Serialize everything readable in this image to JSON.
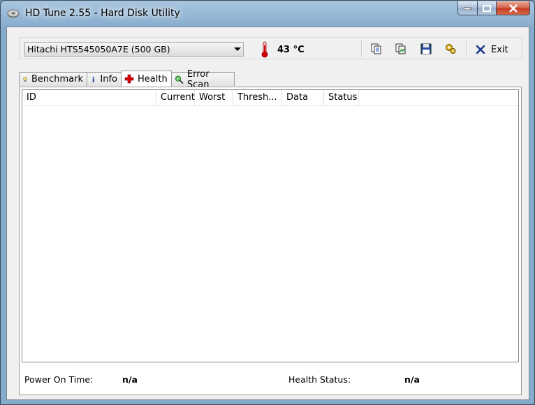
{
  "window": {
    "title": "HD Tune 2.55 - Hard Disk Utility",
    "controls": [
      "minimize",
      "maximize",
      "close"
    ]
  },
  "toolbar": {
    "drive_select_value": "Hitachi HTS545050A7E (500 GB)",
    "temperature": "43 °C",
    "icons": [
      "copy-info-icon",
      "copy-screenshot-icon",
      "save-icon",
      "options-icon",
      "exit-icon"
    ],
    "exit_label": "Exit"
  },
  "tabs": [
    {
      "label": "Benchmark",
      "icon": "benchmark-icon"
    },
    {
      "label": "Info",
      "icon": "info-icon"
    },
    {
      "label": "Health",
      "icon": "health-cross-icon",
      "active": true
    },
    {
      "label": "Error Scan",
      "icon": "magnifier-icon"
    }
  ],
  "health": {
    "columns": [
      "ID",
      "Current",
      "Worst",
      "Thresh...",
      "Data",
      "Status"
    ],
    "rows": [],
    "power_on_time_label": "Power On Time:",
    "power_on_time_value": "n/a",
    "health_status_label": "Health Status:",
    "health_status_value": "n/a"
  },
  "colors": {
    "titlebar": "#a9c6e0",
    "close_button": "#c4391f",
    "health_cross": "#d40000"
  }
}
